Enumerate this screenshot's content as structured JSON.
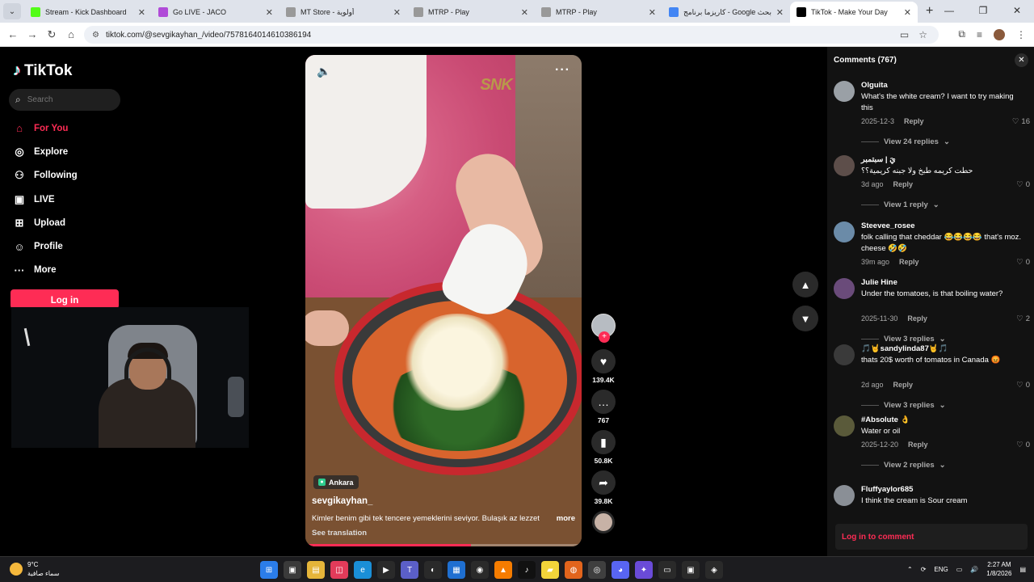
{
  "browser": {
    "tabs": [
      {
        "title": "Stream - Kick Dashboard",
        "color": "#53fc18",
        "active": false
      },
      {
        "title": "Go LIVE - JACO",
        "color": "#b04bd8",
        "active": false
      },
      {
        "title": "MT Store - أولوية",
        "color": "#999999",
        "active": false
      },
      {
        "title": "MTRP - Play",
        "color": "#999999",
        "active": false
      },
      {
        "title": "MTRP - Play",
        "color": "#999999",
        "active": false
      },
      {
        "title": "كاريزما برنامج - Google بحث",
        "color": "#4285f4",
        "active": false
      },
      {
        "title": "TikTok - Make Your Day",
        "color": "#000000",
        "active": true
      }
    ],
    "url": "tiktok.com/@sevgikayhan_/video/7578164014610386194"
  },
  "sidebar": {
    "logo": "TikTok",
    "search_placeholder": "Search",
    "menu": [
      {
        "label": "For You",
        "icon": "home-icon",
        "active": true
      },
      {
        "label": "Explore",
        "icon": "compass-icon",
        "active": false
      },
      {
        "label": "Following",
        "icon": "user-icon",
        "active": false
      },
      {
        "label": "LIVE",
        "icon": "live-icon",
        "active": false
      },
      {
        "label": "Upload",
        "icon": "upload-icon",
        "active": false
      },
      {
        "label": "Profile",
        "icon": "profile-icon",
        "active": false
      },
      {
        "label": "More",
        "icon": "more-icon",
        "active": false
      }
    ],
    "login_label": "Log in"
  },
  "video": {
    "location": "Ankara",
    "username": "sevgikayhan_",
    "description": "Kimler benim gibi tek tencere yemeklerini seviyor. Bulaşık az lezzet",
    "more_label": "more",
    "translation_label": "See translation",
    "progress": 0.6
  },
  "actions": {
    "likes": "139.4K",
    "comments": "767",
    "saves": "50.8K",
    "shares": "39.8K"
  },
  "comments_panel": {
    "title": "Comments (767)",
    "login_prompt": "Log in to comment",
    "reply_label": "Reply",
    "items": [
      {
        "user": "Olguita",
        "text": "What's the white cream? I want to try making this",
        "date": "2025-12-3",
        "likes": "16",
        "view_replies": "View 24 replies",
        "avatar_color": "#9aa0a6"
      },
      {
        "user": "يَ | سبتمبر",
        "text": "حطت كريمه طبخ ولا جبنه كريمية؟؟",
        "date": "3d ago",
        "likes": "0",
        "view_replies": "View 1 reply",
        "avatar_color": "#5d4e4a"
      },
      {
        "user": "Steevee_rosee",
        "text": "folk calling that cheddar 😂😂😂😂 that's moz. cheese 🤣🤣",
        "date": "39m ago",
        "likes": "0",
        "view_replies": "",
        "avatar_color": "#6b8ba8"
      },
      {
        "user": "Julie Hine",
        "text": "Under the tomatoes, is that boiling water?",
        "date": "2025-11-30",
        "likes": "2",
        "view_replies": "View 3 replies",
        "avatar_color": "#6a4b7a"
      },
      {
        "user": "🎵🤘sandylinda87🤘🎵",
        "text": "thats 20$ worth of tomatos in Canada 😡",
        "date": "2d ago",
        "likes": "0",
        "view_replies": "View 3 replies",
        "avatar_color": "#3a3a3a"
      },
      {
        "user": "#Absolute 👌",
        "text": "Water or oil",
        "date": "2025-12-20",
        "likes": "0",
        "view_replies": "View 2 replies",
        "avatar_color": "#5a5a3a"
      },
      {
        "user": "Fluffyaylor685",
        "text": "I think the cream is Sour cream",
        "date": "",
        "likes": "",
        "view_replies": "",
        "avatar_color": "#8a8f96"
      }
    ]
  },
  "taskbar": {
    "temperature": "9°C",
    "weather": "سماء صافية",
    "language": "ENG",
    "time": "2:27 AM",
    "date": "1/8/2026"
  },
  "watermark": "SNK"
}
